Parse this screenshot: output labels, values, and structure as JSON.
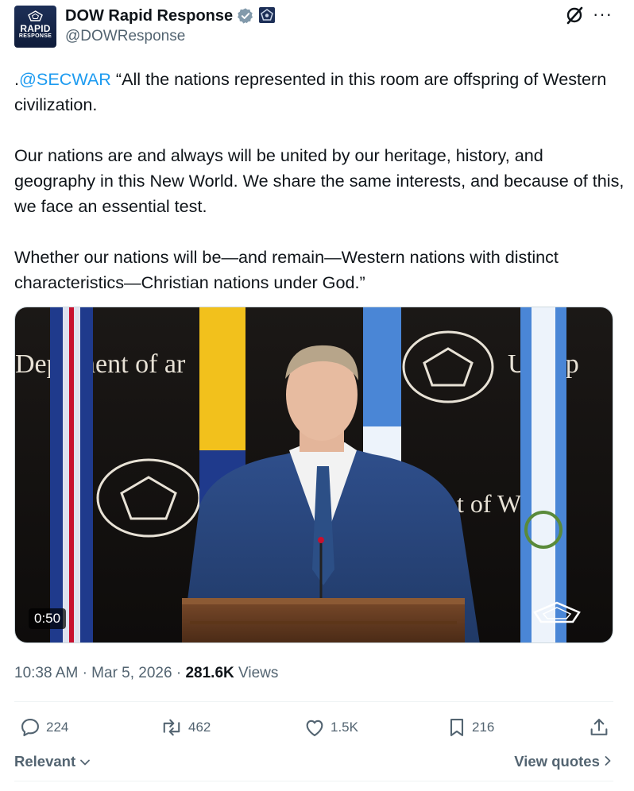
{
  "author": {
    "display_name": "DOW Rapid Response",
    "handle": "@DOWResponse",
    "avatar_line1": "RAPID",
    "avatar_line2": "RESPONSE",
    "verified_color": "#829aab"
  },
  "tweet": {
    "mention": "@SECWAR",
    "para1_prefix": ".",
    "para1_rest": " “All the nations represented in this room are offspring of Western civilization.",
    "para2": "Our nations are and always will be united by our heritage, history, and geography in this New World. We share the same interests, and because of this, we face an essential test.",
    "para3": "Whether our nations will be—and remain—Western nations with distinct characteristics—Christian nations under God.”"
  },
  "media": {
    "duration": "0:50",
    "backdrop_text_left": "Dep    tment of     ar",
    "backdrop_text_right_top": "U   Dep",
    "backdrop_text_mid": "nt of W"
  },
  "meta": {
    "time": "10:38 AM",
    "date": "Mar 5, 2026",
    "views_count": "281.6K",
    "views_label": "Views",
    "separator": "·"
  },
  "actions": {
    "replies": "224",
    "reposts": "462",
    "likes": "1.5K",
    "bookmarks": "216"
  },
  "footer": {
    "sort_label": "Relevant",
    "view_quotes": "View quotes"
  },
  "colors": {
    "accent": "#1d9bf0",
    "muted": "#536471",
    "text": "#0f1419"
  }
}
